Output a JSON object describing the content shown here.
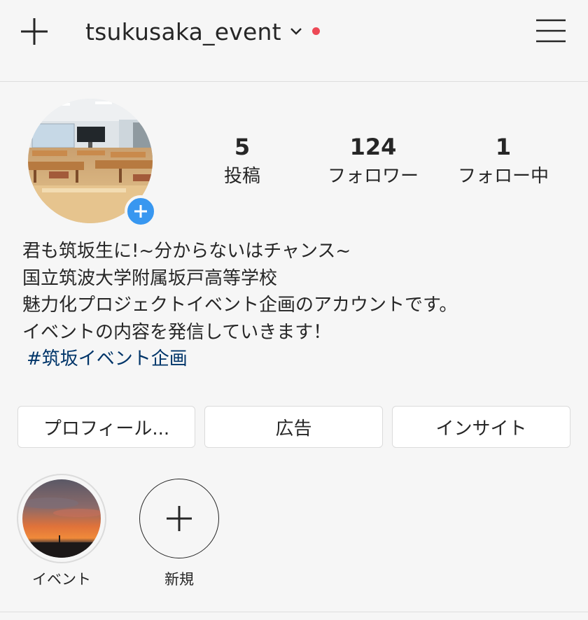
{
  "header": {
    "username": "tsukusaka_event",
    "new_post_icon": "plus-icon",
    "account_switch_icon": "chevron-down-icon",
    "menu_icon": "hamburger-menu-icon",
    "notification_dot_color": "#ed4956"
  },
  "profile": {
    "avatar_icon": "profile-photo",
    "add_story_icon": "plus-icon",
    "stats": [
      {
        "value": "5",
        "label": "投稿"
      },
      {
        "value": "124",
        "label": "フォロワー"
      },
      {
        "value": "1",
        "label": "フォロー中"
      }
    ],
    "bio": {
      "lines": [
        "君も筑坂生に!~分からないはチャンス~",
        "国立筑波大学附属坂戸高等学校",
        "魅力化プロジェクトイベント企画のアカウントです。",
        "イベントの内容を発信していきます！"
      ],
      "hashtag": "#筑坂イベント企画"
    }
  },
  "actions": {
    "edit_profile": "プロフィール...",
    "promotions": "広告",
    "insights": "インサイト"
  },
  "highlights": [
    {
      "label": "イベント"
    },
    {
      "label": "新規"
    }
  ],
  "colors": {
    "accent_blue": "#3897f0",
    "hashtag": "#003569",
    "background": "#f6f6f6"
  }
}
